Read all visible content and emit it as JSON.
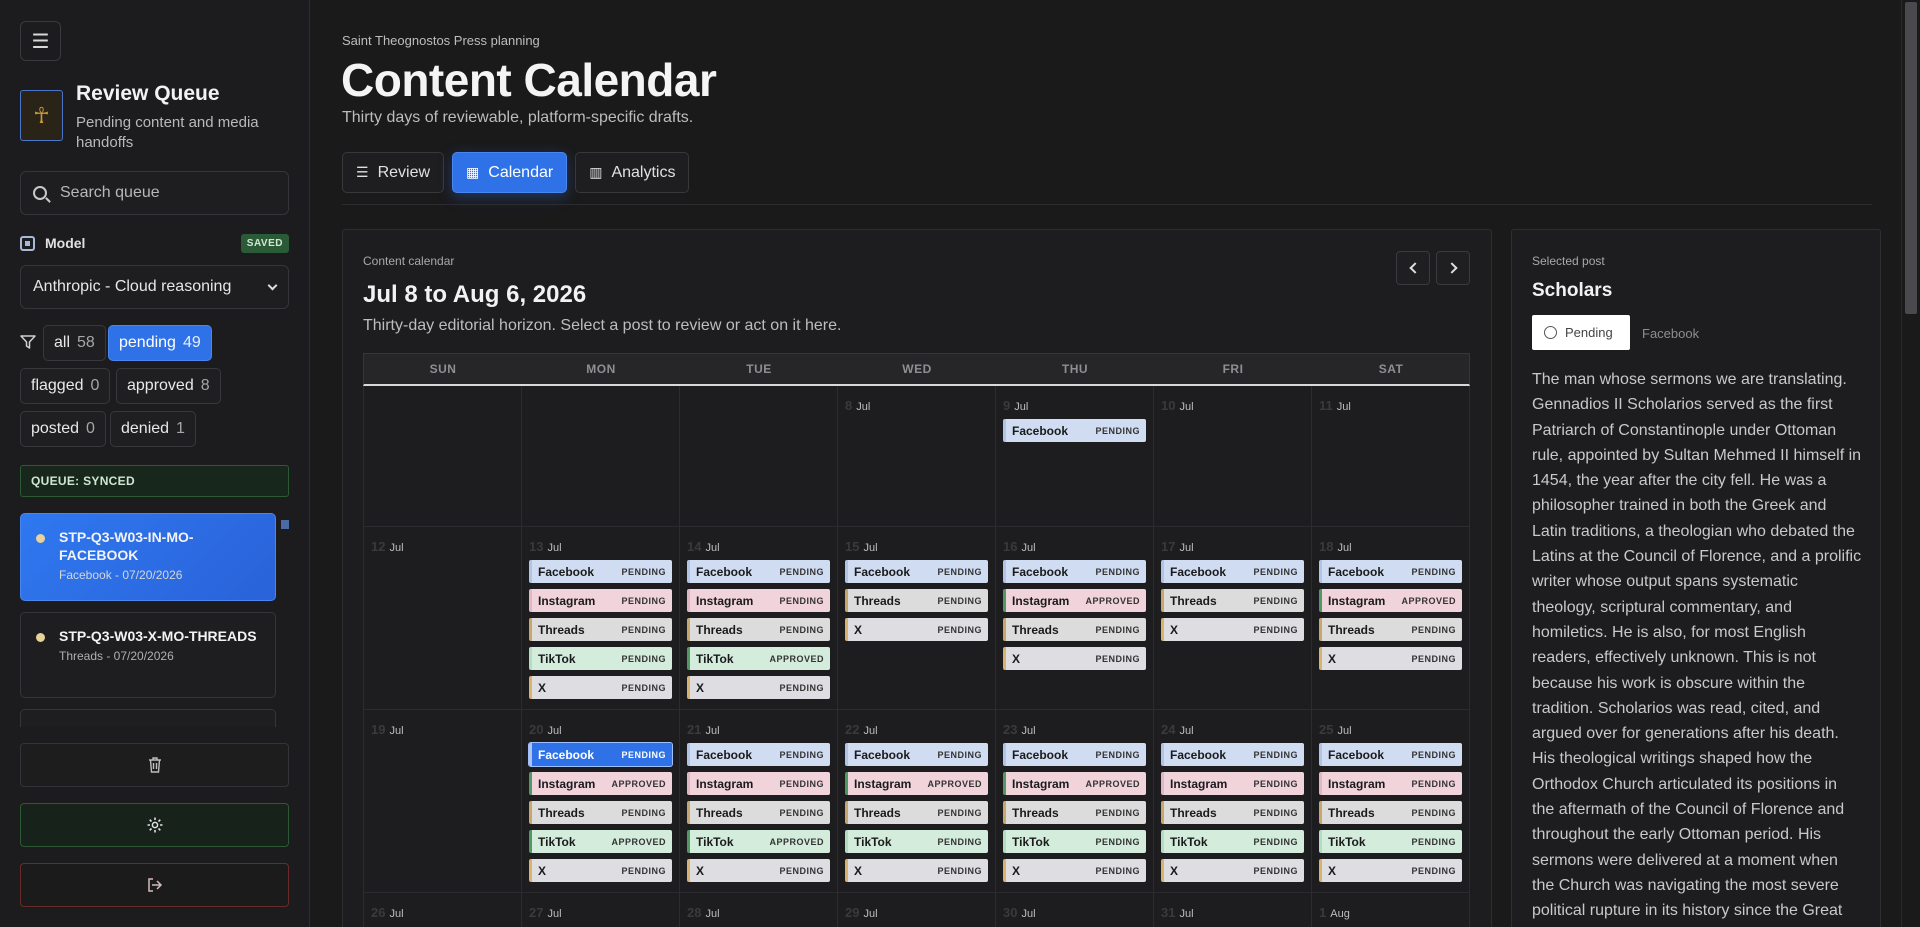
{
  "sidebar": {
    "brand_title": "Review Queue",
    "brand_subtitle": "Pending content and media handoffs",
    "search_placeholder": "Search queue",
    "model_label": "Model",
    "saved_badge": "SAVED",
    "model_value": "Anthropic - Cloud reasoning",
    "filters": [
      {
        "label": "all",
        "count": "58"
      },
      {
        "label": "pending",
        "count": "49"
      },
      {
        "label": "flagged",
        "count": "0"
      },
      {
        "label": "approved",
        "count": "8"
      },
      {
        "label": "posted",
        "count": "0"
      },
      {
        "label": "denied",
        "count": "1"
      }
    ],
    "queue_status": "QUEUE: SYNCED",
    "queue_items": [
      {
        "title": "STP-Q3-W03-IN-MO-FACEBOOK",
        "sub": "Facebook - 07/20/2026"
      },
      {
        "title": "STP-Q3-W03-X-MO-THREADS",
        "sub": "Threads - 07/20/2026"
      }
    ]
  },
  "header": {
    "eyebrow": "Saint Theognostos Press planning",
    "title": "Content Calendar",
    "subtitle": "Thirty days of reviewable, platform-specific drafts.",
    "tabs": [
      {
        "label": "Review",
        "icon": "list-check-icon"
      },
      {
        "label": "Calendar",
        "icon": "calendar-icon"
      },
      {
        "label": "Analytics",
        "icon": "bar-chart-icon"
      }
    ]
  },
  "calendar": {
    "eyebrow": "Content calendar",
    "range": "Jul 8 to Aug 6, 2026",
    "subtitle": "Thirty-day editorial horizon. Select a post to review or act on it here.",
    "days_of_week": [
      "SUN",
      "MON",
      "TUE",
      "WED",
      "THU",
      "FRI",
      "SAT"
    ],
    "weeks": [
      [
        {
          "day": "",
          "month": "",
          "posts": []
        },
        {
          "day": "",
          "month": "",
          "posts": []
        },
        {
          "day": "",
          "month": "",
          "posts": []
        },
        {
          "day": "8",
          "month": "Jul",
          "posts": []
        },
        {
          "day": "9",
          "month": "Jul",
          "posts": [
            {
              "platform": "Facebook",
              "status": "PENDING"
            }
          ]
        },
        {
          "day": "10",
          "month": "Jul",
          "posts": []
        },
        {
          "day": "11",
          "month": "Jul",
          "posts": []
        }
      ],
      [
        {
          "day": "12",
          "month": "Jul",
          "posts": []
        },
        {
          "day": "13",
          "month": "Jul",
          "posts": [
            {
              "platform": "Facebook",
              "status": "PENDING"
            },
            {
              "platform": "Instagram",
              "status": "PENDING"
            },
            {
              "platform": "Threads",
              "status": "PENDING"
            },
            {
              "platform": "TikTok",
              "status": "PENDING"
            },
            {
              "platform": "X",
              "status": "PENDING"
            }
          ]
        },
        {
          "day": "14",
          "month": "Jul",
          "posts": [
            {
              "platform": "Facebook",
              "status": "PENDING"
            },
            {
              "platform": "Instagram",
              "status": "PENDING"
            },
            {
              "platform": "Threads",
              "status": "PENDING"
            },
            {
              "platform": "TikTok",
              "status": "APPROVED"
            },
            {
              "platform": "X",
              "status": "PENDING"
            }
          ]
        },
        {
          "day": "15",
          "month": "Jul",
          "posts": [
            {
              "platform": "Facebook",
              "status": "PENDING"
            },
            {
              "platform": "Threads",
              "status": "PENDING"
            },
            {
              "platform": "X",
              "status": "PENDING"
            }
          ]
        },
        {
          "day": "16",
          "month": "Jul",
          "posts": [
            {
              "platform": "Facebook",
              "status": "PENDING"
            },
            {
              "platform": "Instagram",
              "status": "APPROVED"
            },
            {
              "platform": "Threads",
              "status": "PENDING"
            },
            {
              "platform": "X",
              "status": "PENDING"
            }
          ]
        },
        {
          "day": "17",
          "month": "Jul",
          "posts": [
            {
              "platform": "Facebook",
              "status": "PENDING"
            },
            {
              "platform": "Threads",
              "status": "PENDING"
            },
            {
              "platform": "X",
              "status": "PENDING"
            }
          ]
        },
        {
          "day": "18",
          "month": "Jul",
          "posts": [
            {
              "platform": "Facebook",
              "status": "PENDING"
            },
            {
              "platform": "Instagram",
              "status": "APPROVED"
            },
            {
              "platform": "Threads",
              "status": "PENDING"
            },
            {
              "platform": "X",
              "status": "PENDING"
            }
          ]
        }
      ],
      [
        {
          "day": "19",
          "month": "Jul",
          "posts": []
        },
        {
          "day": "20",
          "month": "Jul",
          "posts": [
            {
              "platform": "Facebook",
              "status": "PENDING",
              "selected": true
            },
            {
              "platform": "Instagram",
              "status": "APPROVED"
            },
            {
              "platform": "Threads",
              "status": "PENDING"
            },
            {
              "platform": "TikTok",
              "status": "APPROVED"
            },
            {
              "platform": "X",
              "status": "PENDING"
            }
          ]
        },
        {
          "day": "21",
          "month": "Jul",
          "posts": [
            {
              "platform": "Facebook",
              "status": "PENDING"
            },
            {
              "platform": "Instagram",
              "status": "PENDING"
            },
            {
              "platform": "Threads",
              "status": "PENDING"
            },
            {
              "platform": "TikTok",
              "status": "APPROVED"
            },
            {
              "platform": "X",
              "status": "PENDING"
            }
          ]
        },
        {
          "day": "22",
          "month": "Jul",
          "posts": [
            {
              "platform": "Facebook",
              "status": "PENDING"
            },
            {
              "platform": "Instagram",
              "status": "APPROVED"
            },
            {
              "platform": "Threads",
              "status": "PENDING"
            },
            {
              "platform": "TikTok",
              "status": "PENDING"
            },
            {
              "platform": "X",
              "status": "PENDING"
            }
          ]
        },
        {
          "day": "23",
          "month": "Jul",
          "posts": [
            {
              "platform": "Facebook",
              "status": "PENDING"
            },
            {
              "platform": "Instagram",
              "status": "APPROVED"
            },
            {
              "platform": "Threads",
              "status": "PENDING"
            },
            {
              "platform": "TikTok",
              "status": "PENDING"
            },
            {
              "platform": "X",
              "status": "PENDING"
            }
          ]
        },
        {
          "day": "24",
          "month": "Jul",
          "posts": [
            {
              "platform": "Facebook",
              "status": "PENDING"
            },
            {
              "platform": "Instagram",
              "status": "PENDING"
            },
            {
              "platform": "Threads",
              "status": "PENDING"
            },
            {
              "platform": "TikTok",
              "status": "PENDING"
            },
            {
              "platform": "X",
              "status": "PENDING"
            }
          ]
        },
        {
          "day": "25",
          "month": "Jul",
          "posts": [
            {
              "platform": "Facebook",
              "status": "PENDING"
            },
            {
              "platform": "Instagram",
              "status": "PENDING"
            },
            {
              "platform": "Threads",
              "status": "PENDING"
            },
            {
              "platform": "TikTok",
              "status": "PENDING"
            },
            {
              "platform": "X",
              "status": "PENDING"
            }
          ]
        }
      ],
      [
        {
          "day": "26",
          "month": "Jul",
          "posts": []
        },
        {
          "day": "27",
          "month": "Jul",
          "posts": []
        },
        {
          "day": "28",
          "month": "Jul",
          "posts": []
        },
        {
          "day": "29",
          "month": "Jul",
          "posts": []
        },
        {
          "day": "30",
          "month": "Jul",
          "posts": []
        },
        {
          "day": "31",
          "month": "Jul",
          "posts": []
        },
        {
          "day": "1",
          "month": "Aug",
          "posts": []
        }
      ]
    ]
  },
  "detail": {
    "eyebrow": "Selected post",
    "title": "Scholars",
    "status": "Pending",
    "platform": "Facebook",
    "body": "The man whose sermons we are translating. Gennadios II Scholarios served as the first Patriarch of Constantinople under Ottoman rule, appointed by Sultan Mehmed II himself in 1454, the year after the city fell. He was a philosopher trained in both the Greek and Latin traditions, a theologian who debated the Latins at the Council of Florence, and a prolific writer whose output spans systematic theology, scriptural commentary, and homiletics. He is also, for most English readers, effectively unknown. This is not because his work is obscure within the tradition. Scholarios was read, cited, and argued over for generations after his death. His theological writings shaped how the Orthodox Church articulated its positions in the aftermath of the Council of Florence and throughout the early Ottoman period. His sermons were delivered at a moment when the Church was navigating the most severe political rupture in its history since the Great"
  }
}
